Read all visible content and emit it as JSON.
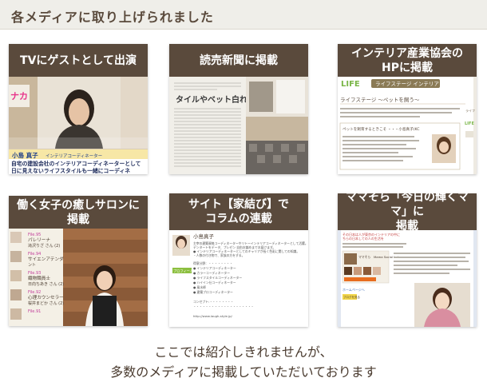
{
  "header": {
    "title": "各メディアに取り上げられました"
  },
  "cards": [
    {
      "title": "TVにゲストとして出演",
      "thumb": {
        "logo": "ナカ",
        "name_plate": "小島 真子",
        "name_role": "インテリアコーディネーター",
        "caption_line1": "自宅の建設会社のインテリアコーディネーターとして",
        "caption_line2": "日に見えないライフスタイルも一緒にコーディネ"
      }
    },
    {
      "title": "読売新聞に掲載",
      "thumb": {
        "headline": "タイルやベット白れて"
      }
    },
    {
      "title": "インテリア産業協会の\nHPに掲載",
      "thumb": {
        "logo": "LIFE",
        "badge": "ライフステージ インテリア",
        "section": "ライフステージ 〜ペットを飼う〜",
        "block_title": "ペットを飼育するときこそ ・・・小島真子(KC",
        "side1": "ライフ",
        "side2": "LIFE"
      }
    },
    {
      "title": "働く女子の癒しサロンに掲載",
      "thumb": {
        "entries": [
          {
            "label": "File.95",
            "name": "パレリーナ",
            "sub": "滝沢りざ さん (2)"
          },
          {
            "label": "File.94",
            "name": "サイエンアテンダ",
            "sub": "ント"
          },
          {
            "label": "File.93",
            "name": "織物職員士",
            "sub": "日向ちあき さん (2)"
          },
          {
            "label": "File.92",
            "name": "心理カウンセラー",
            "sub": "桜井まどか さん (2)"
          },
          {
            "label": "File.91",
            "name": "",
            "sub": ""
          }
        ]
      }
    },
    {
      "title": "サイト【家結び】で\nコラムの連載",
      "thumb": {
        "name": "小島真子",
        "profile_btn": "プロフィール",
        "lines": [
          "主宰の建築資格コーディネーターやリトーインテリアコーディネーターとして活躍。",
          "デンタートをデータ、プレゼン 自由お鎮めまでお届けます。",
          "● インテリアコーディネーターとしてのキャリアが長く色彩に関しての知識。",
          "・人数の付き物で、家族の方をする。",
          "",
          "得意分野：・・・・・・・・",
          "● インテリアコーディネーター",
          "● カラーコーディネーター",
          "● ライフスタイルコーディネーター",
          "● ハイイン仕コーディネーター",
          "● 風水師",
          "● 建築プロコーディネーター",
          "",
          "コンセプト:・・・・・・・・",
          "・・・・・・・・・・・・・・・・・・・・",
          "http://www.laugh-style.jp/"
        ]
      }
    },
    {
      "title": "ママそら「今日の輝くママ」に\n掲載",
      "thumb": {
        "header_lines": [
          "その日本は人が東京のインテリアの中に",
          "ちらの日本しての人の生活を"
        ],
        "site": "ママそら　Mama Social Labo.",
        "side_btn": "ブログを見る",
        "link": "ホームページへ"
      }
    }
  ],
  "footer": {
    "line1": "ここでは紹介しきれませんが、",
    "line2": "多数のメディアに掲載していただいております"
  }
}
